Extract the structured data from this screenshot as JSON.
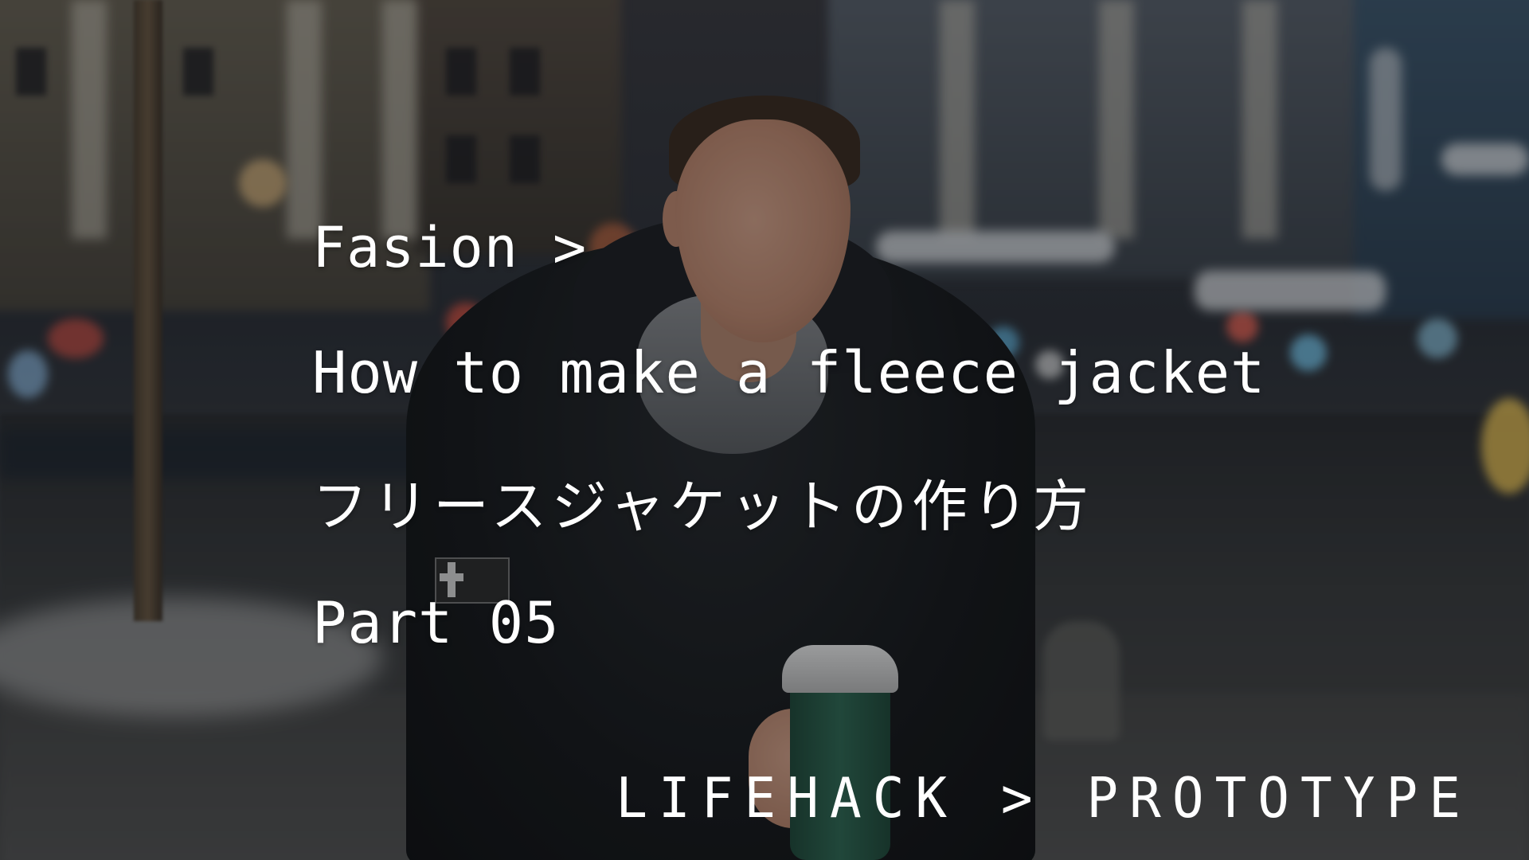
{
  "breadcrumb": "Fasion >",
  "title_en": "How to make a fleece jacket",
  "title_ja": "フリースジャケットの作り方",
  "part": "Part 05",
  "brand": "LIFEHACK > PROTOTYPE",
  "colors": {
    "text": "#ffffff",
    "overlay": "#0a0c10"
  },
  "icons": [
    "jacket-patch-icon"
  ]
}
